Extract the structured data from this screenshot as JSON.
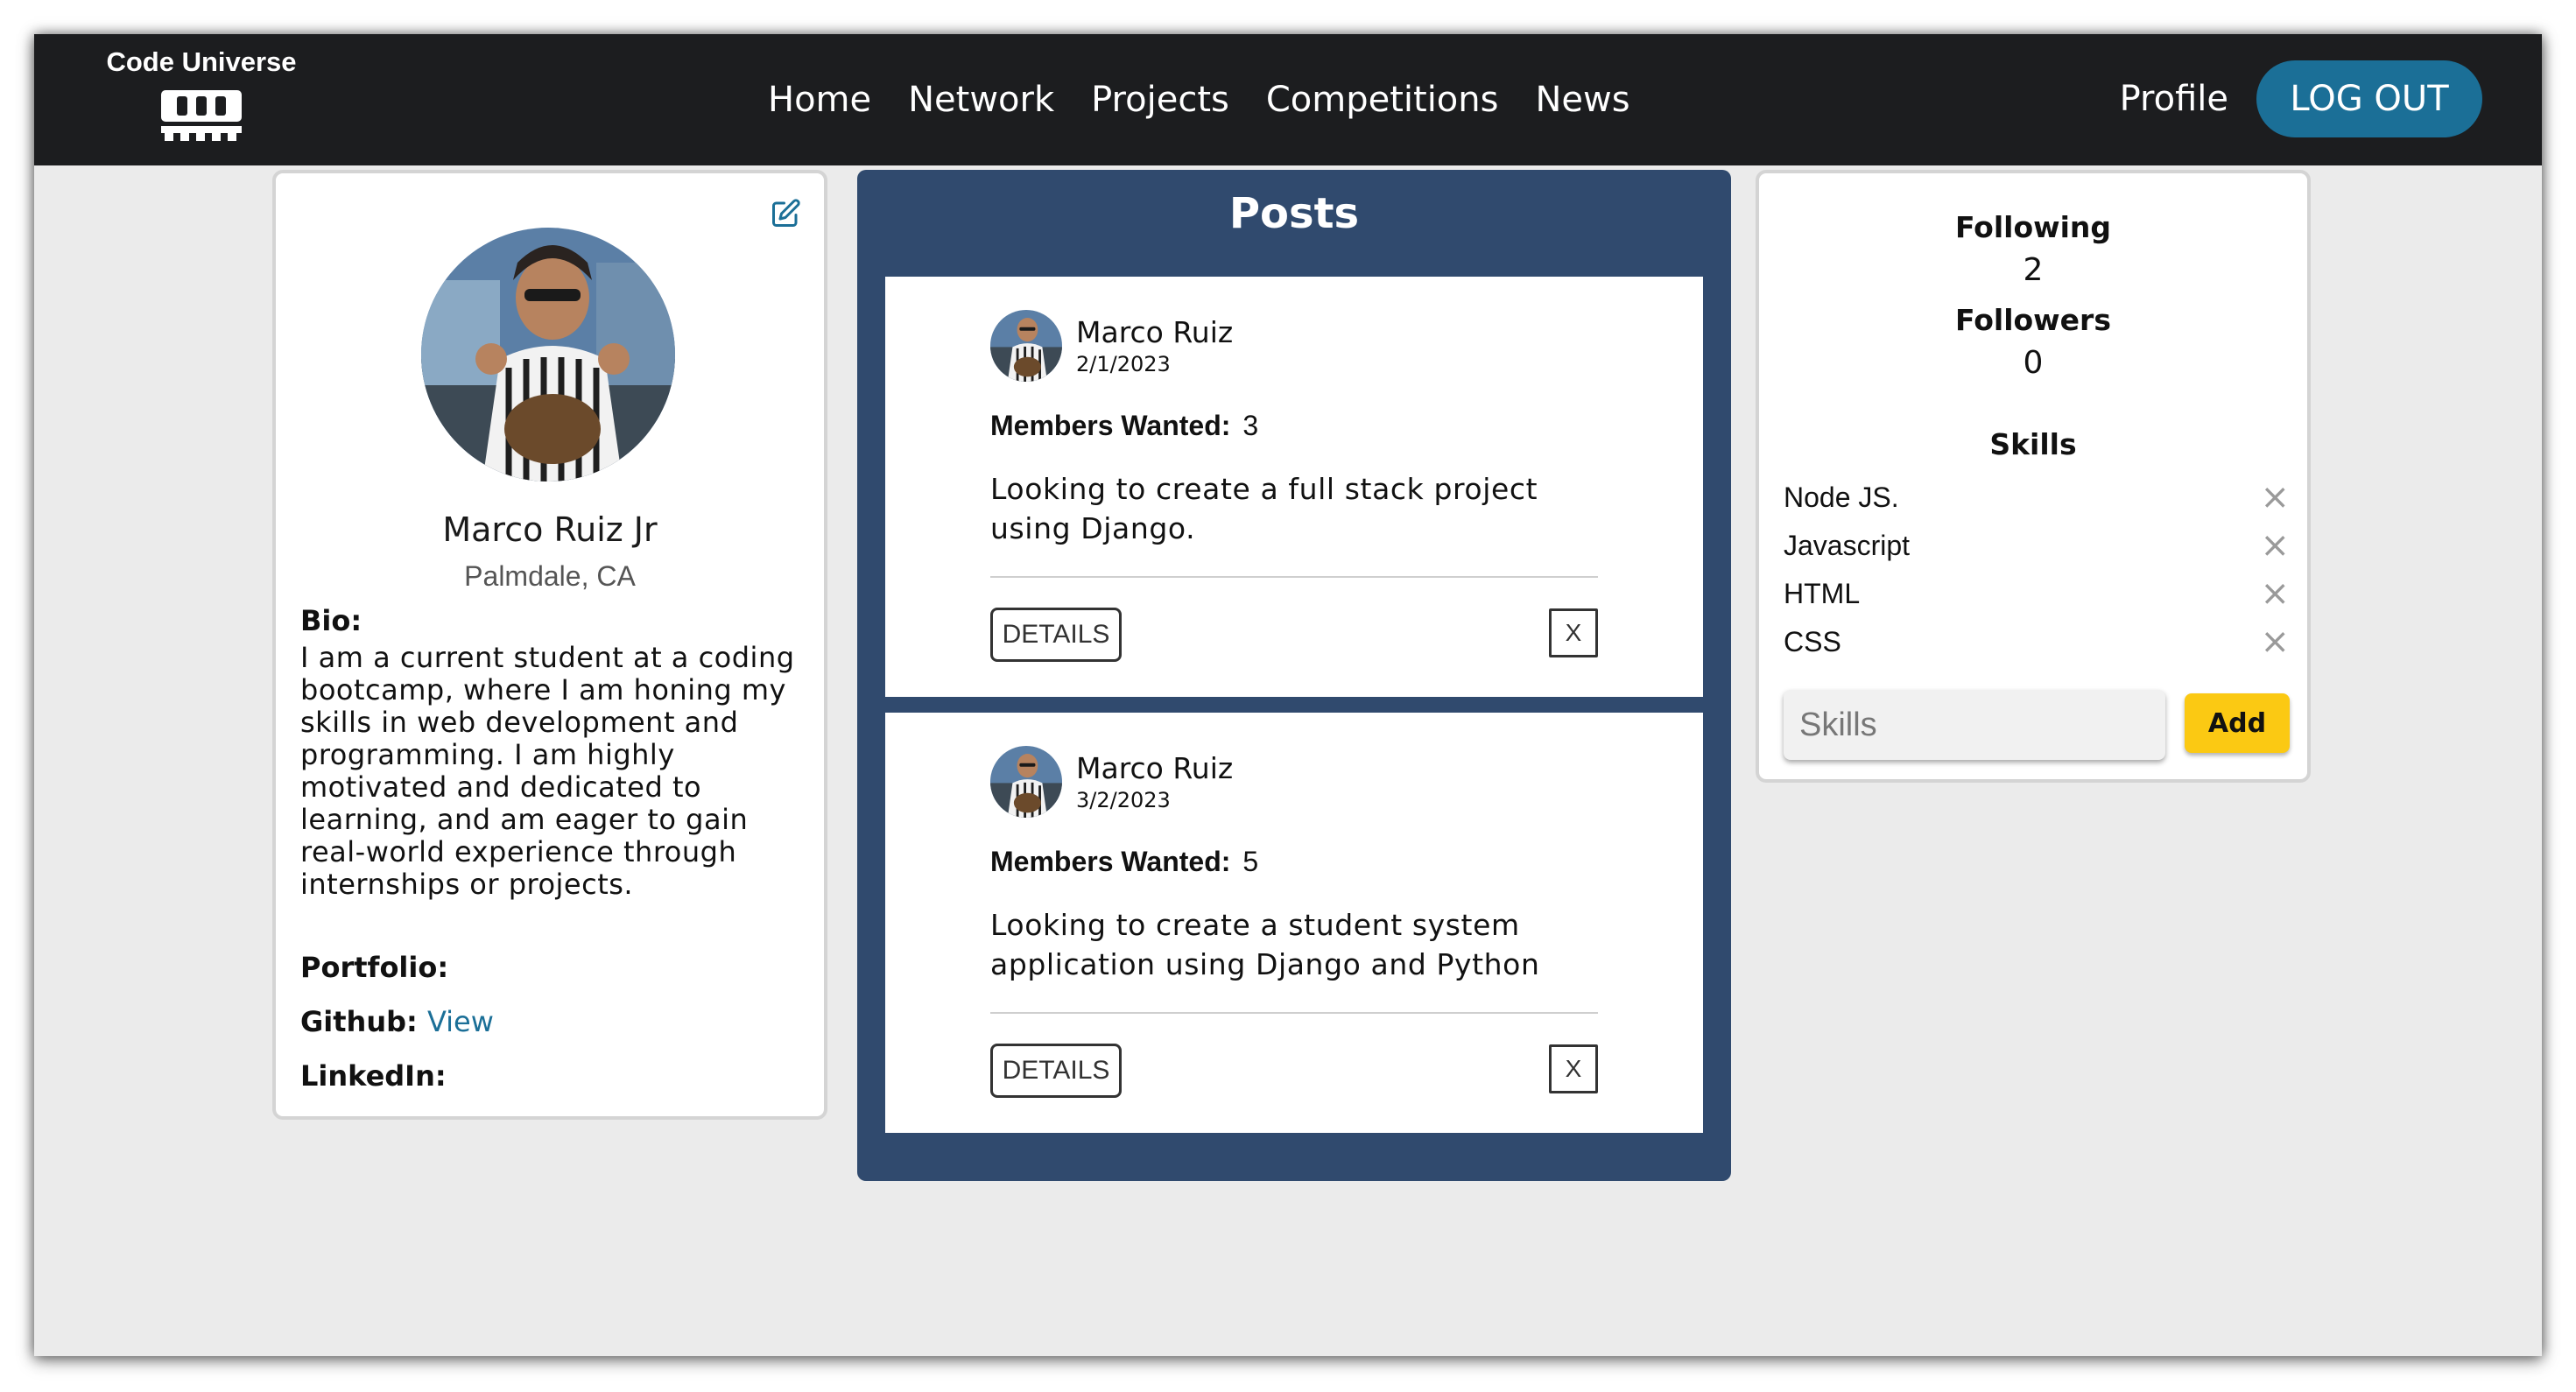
{
  "navbar": {
    "brand": "Code Universe",
    "links": [
      "Home",
      "Network",
      "Projects",
      "Competitions",
      "News"
    ],
    "profile": "Profile",
    "logout": "LOG OUT"
  },
  "profile": {
    "name": "Marco Ruiz Jr",
    "location": "Palmdale, CA",
    "bio_label": "Bio:",
    "bio": "I am a current student at a coding bootcamp, where I am honing my skills in web development and programming. I am highly motivated and dedicated to learning, and am eager to gain real-world experience through internships or projects.",
    "portfolio_label": "Portfolio:",
    "github_label": "Github:",
    "github_link": "View",
    "linkedin_label": "LinkedIn:"
  },
  "posts": {
    "title": "Posts",
    "items": [
      {
        "author": "Marco Ruiz",
        "date": "2/1/2023",
        "wanted_label": "Members Wanted:",
        "wanted": "3",
        "description": "Looking to create a full stack project using Django.",
        "details": "DETAILS",
        "close": "X"
      },
      {
        "author": "Marco Ruiz",
        "date": "3/2/2023",
        "wanted_label": "Members Wanted:",
        "wanted": "5",
        "description": "Looking to create a student system application using Django and Python",
        "details": "DETAILS",
        "close": "X"
      }
    ]
  },
  "stats": {
    "following_label": "Following",
    "following": "2",
    "followers_label": "Followers",
    "followers": "0",
    "skills_label": "Skills",
    "skills": [
      "Node JS.",
      "Javascript",
      "HTML",
      "CSS"
    ],
    "skill_placeholder": "Skills",
    "add": "Add"
  },
  "colors": {
    "navbar": "#1c1d1f",
    "accent": "#1b6f97",
    "posts_panel": "#304a6e",
    "add_button": "#fbc913",
    "background": "#ebebeb"
  },
  "icons": {
    "edit": "edit-square-icon",
    "remove": "close-x-icon",
    "logo": "keyboard-icon"
  }
}
